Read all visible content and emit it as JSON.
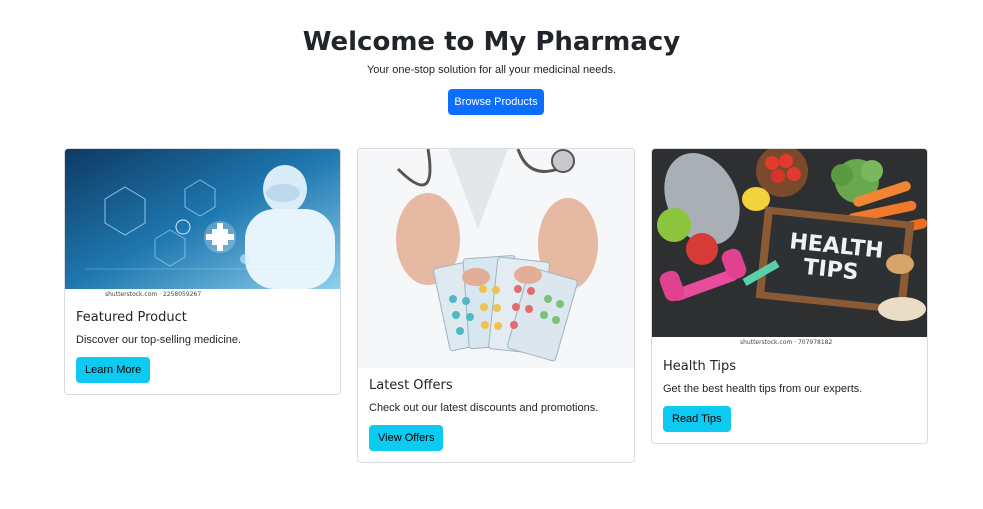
{
  "hero": {
    "title": "Welcome to My Pharmacy",
    "subtitle": "Your one-stop solution for all your medicinal needs.",
    "cta_label": "Browse Products"
  },
  "cards": [
    {
      "title": "Featured Product",
      "text": "Discover our top-selling medicine.",
      "button_label": "Learn More",
      "image_credit": "shutterstock.com · 2258059267"
    },
    {
      "title": "Latest Offers",
      "text": "Check out our latest discounts and promotions.",
      "button_label": "View Offers"
    },
    {
      "title": "Health Tips",
      "text": "Get the best health tips from our experts.",
      "button_label": "Read Tips",
      "image_credit": "shutterstock.com · 707978182",
      "image_board_text_line1": "HEALTH",
      "image_board_text_line2": "TIPS"
    }
  ],
  "colors": {
    "primary": "#0d6efd",
    "info": "#0dcaf0",
    "text": "#212529",
    "card_border": "#d9dce0"
  }
}
